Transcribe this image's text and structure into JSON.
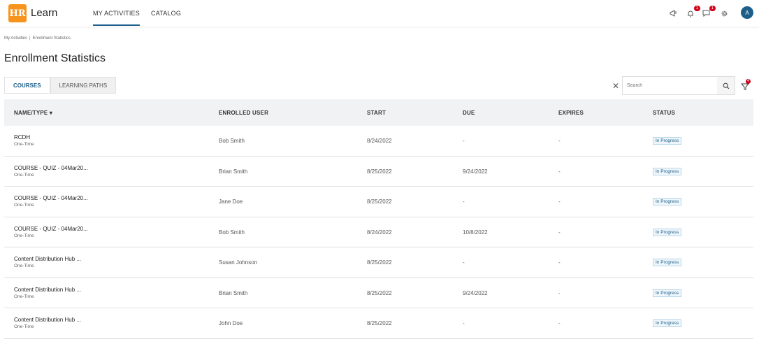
{
  "header": {
    "logo_text": "HR",
    "app_name": "Learn",
    "nav": [
      {
        "label": "MY ACTIVITIES"
      },
      {
        "label": "CATALOG"
      }
    ],
    "icons": [
      {
        "name": "megaphone-icon",
        "badge": ""
      },
      {
        "name": "bell-icon",
        "badge": "1"
      },
      {
        "name": "chat-icon",
        "badge": "1"
      },
      {
        "name": "gear-icon",
        "badge": ""
      }
    ],
    "avatar_initial": "A"
  },
  "breadcrumb": [
    "My Activities",
    "Enrollment Statistics"
  ],
  "page_title": "Enrollment Statistics",
  "tabs": [
    {
      "label": "COURSES",
      "active": true
    },
    {
      "label": "LEARNING PATHS",
      "active": false
    }
  ],
  "search": {
    "placeholder": "Search",
    "filter_badge": "4"
  },
  "table": {
    "columns": [
      "NAME/TYPE",
      "ENROLLED USER",
      "START",
      "DUE",
      "EXPIRES",
      "STATUS"
    ],
    "sort_indicator": "▾",
    "rows": [
      {
        "name": "RCDH",
        "type": "One-Time",
        "user": "Bob Smith",
        "start": "8/24/2022",
        "due": "-",
        "expires": "-",
        "status": "In Progress"
      },
      {
        "name": "COURSE - QUIZ - 04Mar20...",
        "type": "One-Time",
        "user": "Brian Smith",
        "start": "8/25/2022",
        "due": "9/24/2022",
        "expires": "-",
        "status": "In Progress"
      },
      {
        "name": "COURSE - QUIZ - 04Mar20...",
        "type": "One-Time",
        "user": "Jane Doe",
        "start": "8/25/2022",
        "due": "-",
        "expires": "-",
        "status": "In Progress"
      },
      {
        "name": "COURSE - QUIZ - 04Mar20...",
        "type": "One-Time",
        "user": "Bob Smith",
        "start": "8/24/2022",
        "due": "10/8/2022",
        "expires": "-",
        "status": "In Progress"
      },
      {
        "name": "Content Distribution Hub ...",
        "type": "One-Time",
        "user": "Susan Johnson",
        "start": "8/25/2022",
        "due": "-",
        "expires": "-",
        "status": "In Progress"
      },
      {
        "name": "Content Distribution Hub ...",
        "type": "One-Time",
        "user": "Brian Smith",
        "start": "8/25/2022",
        "due": "9/24/2022",
        "expires": "-",
        "status": "In Progress"
      },
      {
        "name": "Content Distribution Hub ...",
        "type": "One-Time",
        "user": "John Doe",
        "start": "8/25/2022",
        "due": "-",
        "expires": "-",
        "status": "In Progress"
      }
    ]
  }
}
